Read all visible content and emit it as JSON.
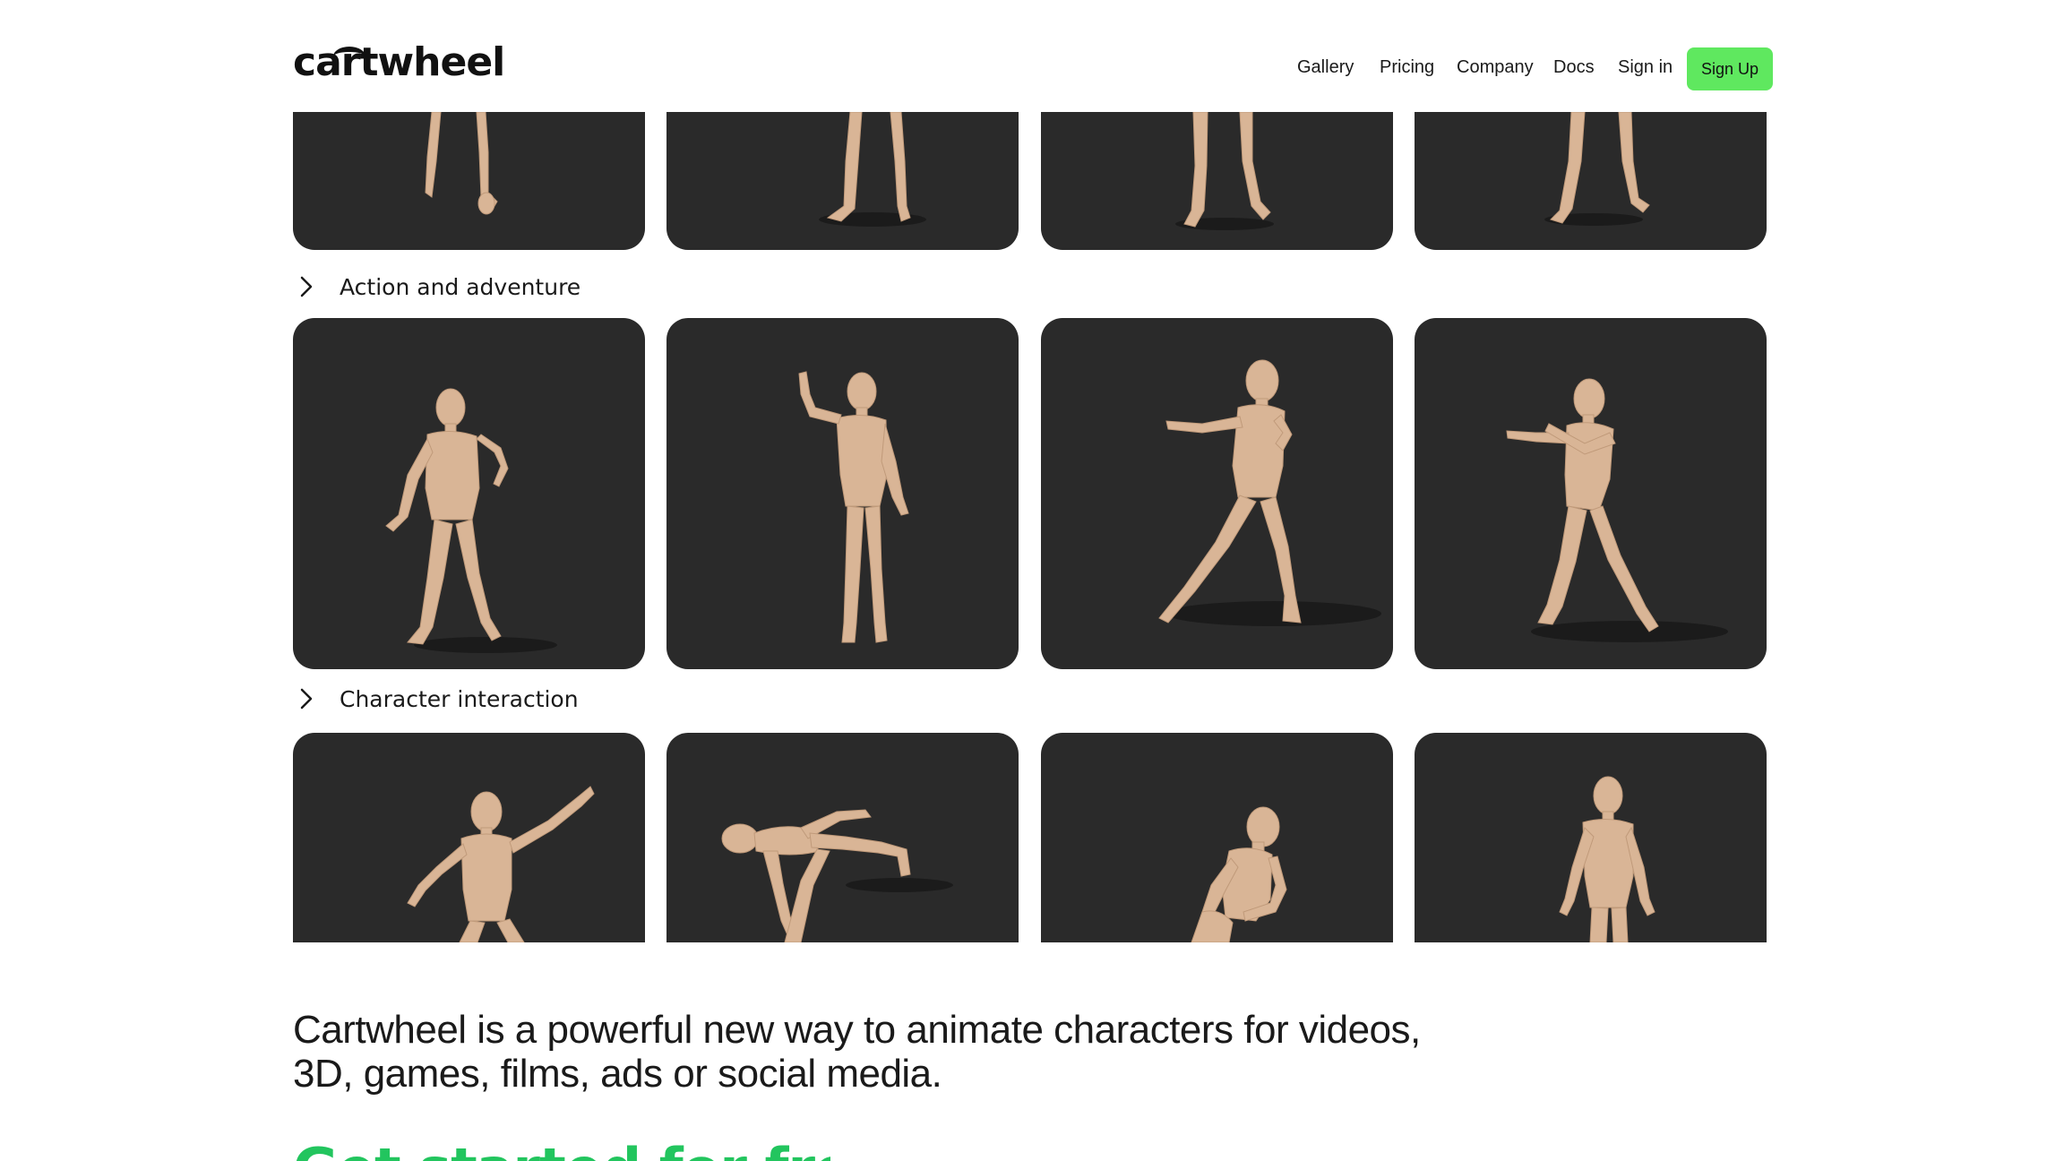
{
  "header": {
    "logo": "cartwheel",
    "nav": [
      "Gallery",
      "Pricing",
      "Company",
      "Docs",
      "Sign in"
    ],
    "signup_label": "Sign Up",
    "signup_color": "#5fe85f"
  },
  "gallery": {
    "sections": [
      {
        "title": "Action and adventure"
      },
      {
        "title": "Character interaction"
      }
    ],
    "tile_color": "#2a2a2a",
    "figure_color": "#d9b596"
  },
  "tagline": "Cartwheel is a powerful new way to animate characters for videos, 3D, games, films, ads or social media.",
  "cta": {
    "label": "Get started for free",
    "color": "#22c55e"
  }
}
